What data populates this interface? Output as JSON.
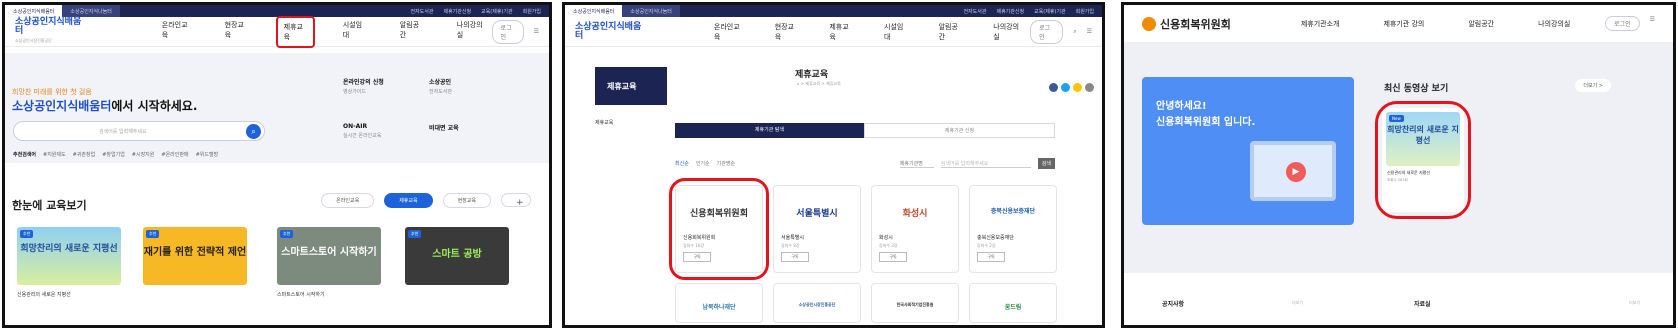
{
  "panel1": {
    "top_tabs": [
      "소상공인지식배움터",
      "소상공인지식나눔터"
    ],
    "top_links": [
      "전자도서관",
      "제휴기관신청",
      "교육(제휴)기관",
      "회원가입"
    ],
    "logo": "소상공인지식배움터",
    "logo_sub": "소상공인시장진흥공단",
    "menu": [
      "온라인교육",
      "현장교육",
      "제휴교육",
      "시설임대",
      "알림공간",
      "나의강의실"
    ],
    "login": "로그인",
    "hero_tagline": "희망찬 미래를 위한 첫 걸음",
    "hero_brand": "소상공인지식배움터",
    "hero_suffix": "에서 시작하세요.",
    "search_placeholder": "검색어를 입력해주세요",
    "keywords_label": "추천검색어",
    "keywords": [
      "#지원제도",
      "#귀촌창업",
      "#창업기업",
      "#시장지원",
      "#온라인판매",
      "#위드텔방"
    ],
    "quick": [
      {
        "title": "온라인강의 신청",
        "sub": "영상가이드"
      },
      {
        "title": "소상공인",
        "sub": "전자도서관"
      },
      {
        "title": "ON-AIR",
        "sub": "실시간 온라인교육"
      },
      {
        "title": "비대면 교육",
        "sub": ""
      }
    ],
    "section_title": "한눈에 교육보기",
    "filters": [
      "온라인교육",
      "제휴교육",
      "현장교육"
    ],
    "plus": "+",
    "cards": [
      {
        "badge": "추천",
        "thumb": "희망찬리의 새로운 지평선",
        "caption": "신용관리의 새로운 지평선"
      },
      {
        "badge": "추천",
        "thumb": "재기를 위한 전략적 제언",
        "caption": ""
      },
      {
        "badge": "추천",
        "thumb": "스마트스토어 시작하기",
        "caption": "스마트스토어 시작하기"
      },
      {
        "badge": "추천",
        "thumb": "스마트 공방",
        "caption": ""
      }
    ]
  },
  "panel2": {
    "top_tabs": [
      "소상공인지식배움터",
      "소상공인지식나눔터"
    ],
    "top_links": [
      "전자도서관",
      "제휴기관신청",
      "교육(제휴)기관",
      "회원가입"
    ],
    "logo": "소상공인지식배움터",
    "menu": [
      "온라인교육",
      "현장교육",
      "제휴교육",
      "시설임대",
      "알림공간",
      "나의강의실"
    ],
    "login": "로그인",
    "side_title": "제휴교육",
    "side_item": "제휴교육",
    "page_title": "제휴교육",
    "breadcrumb": "⌂ > 제휴교육 > 제휴교육",
    "tab_active": "제휴기관 탐색",
    "tab_other": "제휴기관 신청",
    "sort": [
      "최신순",
      "인기순",
      "기관명순"
    ],
    "select": "제휴기관명",
    "search_placeholder": "검색어를 입력해주세요",
    "search_btn": "검색",
    "orgs": [
      {
        "logo": "신용회복위원회",
        "name": "신용회복위원회",
        "count": "강좌수 16강",
        "btn": "구독"
      },
      {
        "logo": "서울특별시",
        "name": "서울특별시",
        "count": "강좌수 8강",
        "btn": "구독"
      },
      {
        "logo": "화성시",
        "name": "화성시",
        "count": "강좌수 3강",
        "btn": "구독"
      },
      {
        "logo": "충북신용보증재단",
        "name": "충북신용보증재단",
        "count": "강좌수 2강",
        "btn": "구독"
      }
    ],
    "orgs_row2": [
      "남북하나재단",
      "소상공인시장진흥공단",
      "한국사회적기업진흥원",
      "꿈드림"
    ]
  },
  "panel3": {
    "brand": "신용회복위원회",
    "menu": [
      "제휴기관소개",
      "제휴기관 강의",
      "알림공간",
      "나의강의실"
    ],
    "login": "로그인",
    "hello": "안녕하세요!",
    "intro": "신용회복위원회 입니다.",
    "latest": "최신 동영상 보기",
    "more": "더보기 >",
    "video": {
      "badge": "New",
      "thumb": "희망찬리의 새로운 지평선",
      "title": "신용관리의 새로운 지평선",
      "sub": "조회수 563회"
    },
    "notice": "공지사항",
    "notice_more": "더보기",
    "resources": "자료실",
    "resources_more": "더보기"
  },
  "colors": {
    "navy": "#1b2452",
    "blue": "#1e62d9",
    "red_highlight": "#e3141d",
    "orange": "#e8851b"
  }
}
